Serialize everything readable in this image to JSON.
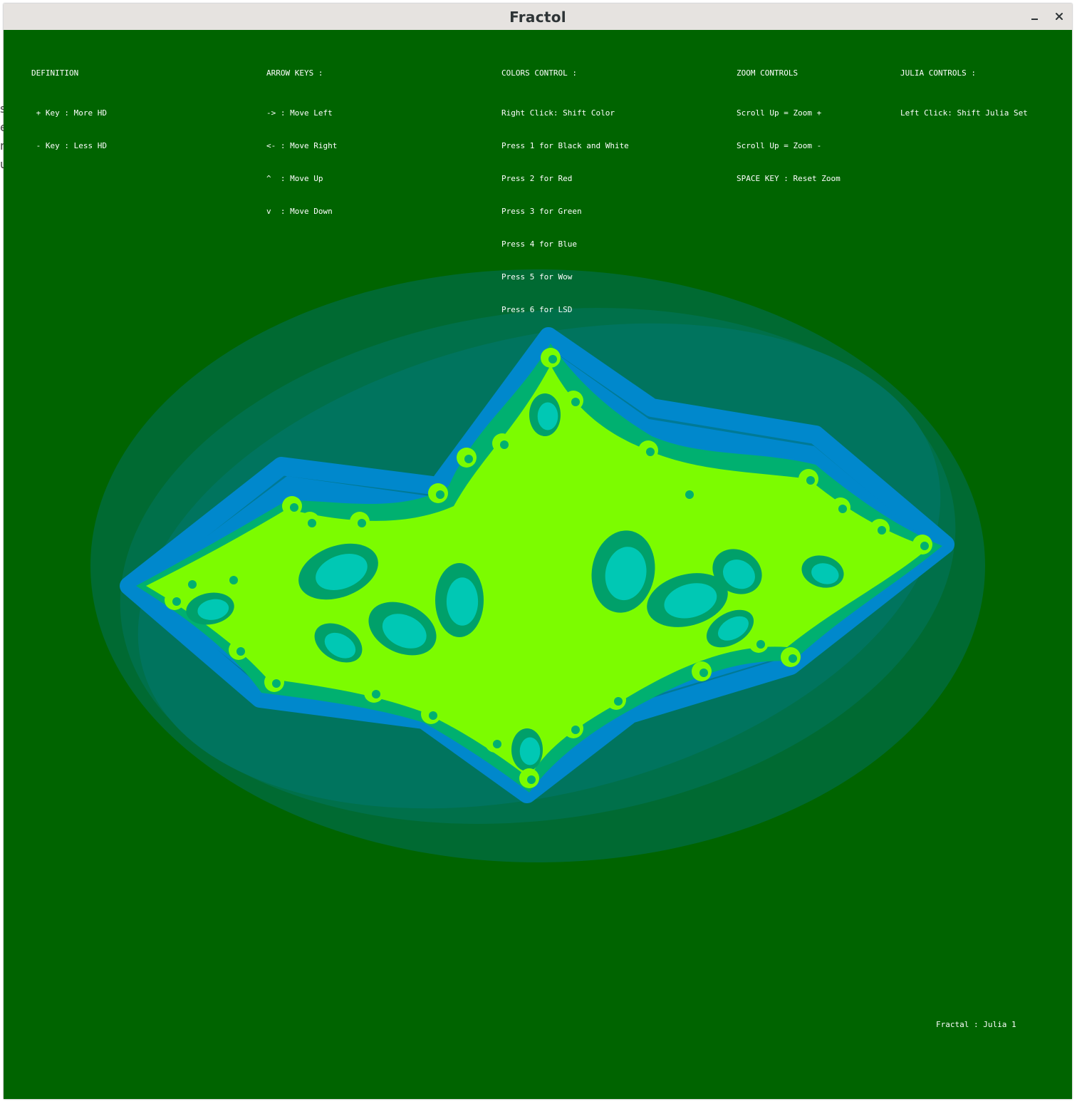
{
  "window": {
    "title": "Fractol",
    "minimize_icon": "minimize-icon",
    "close_icon": "close-icon"
  },
  "colors": {
    "background": "#006400",
    "ring_outer": "#006a32",
    "ring_2": "#00704a",
    "ring_3": "#00745e",
    "ring_4": "#007a96",
    "ring_5": "#0088cc",
    "set_inner": "#00b070",
    "set_fill": "#7cfc00",
    "text": "#ffffff"
  },
  "help": {
    "definition": {
      "header": "DEFINITION",
      "lines": [
        " + Key : More HD",
        " - Key : Less HD"
      ]
    },
    "arrow_keys": {
      "header": "ARROW KEYS :",
      "lines": [
        "-> : Move Left",
        "<- : Move Right",
        "^  : Move Up",
        "v  : Move Down"
      ]
    },
    "colors_control": {
      "header": "COLORS CONTROL :",
      "lines": [
        "Right Click: Shift Color",
        "Press 1 for Black and White",
        "Press 2 for Red",
        "Press 3 for Green",
        "Press 4 for Blue",
        "Press 5 for Wow",
        "Press 6 for LSD"
      ]
    },
    "zoom_controls": {
      "header": "ZOOM CONTROLS",
      "lines": [
        "Scroll Up = Zoom +",
        "Scroll Up = Zoom -",
        "SPACE KEY : Reset Zoom"
      ]
    },
    "julia_controls": {
      "header": "JULIA CONTROLS :",
      "lines": [
        "Left Click: Shift Julia Set"
      ]
    }
  },
  "status": {
    "fractal": "Fractal : Julia 1"
  }
}
